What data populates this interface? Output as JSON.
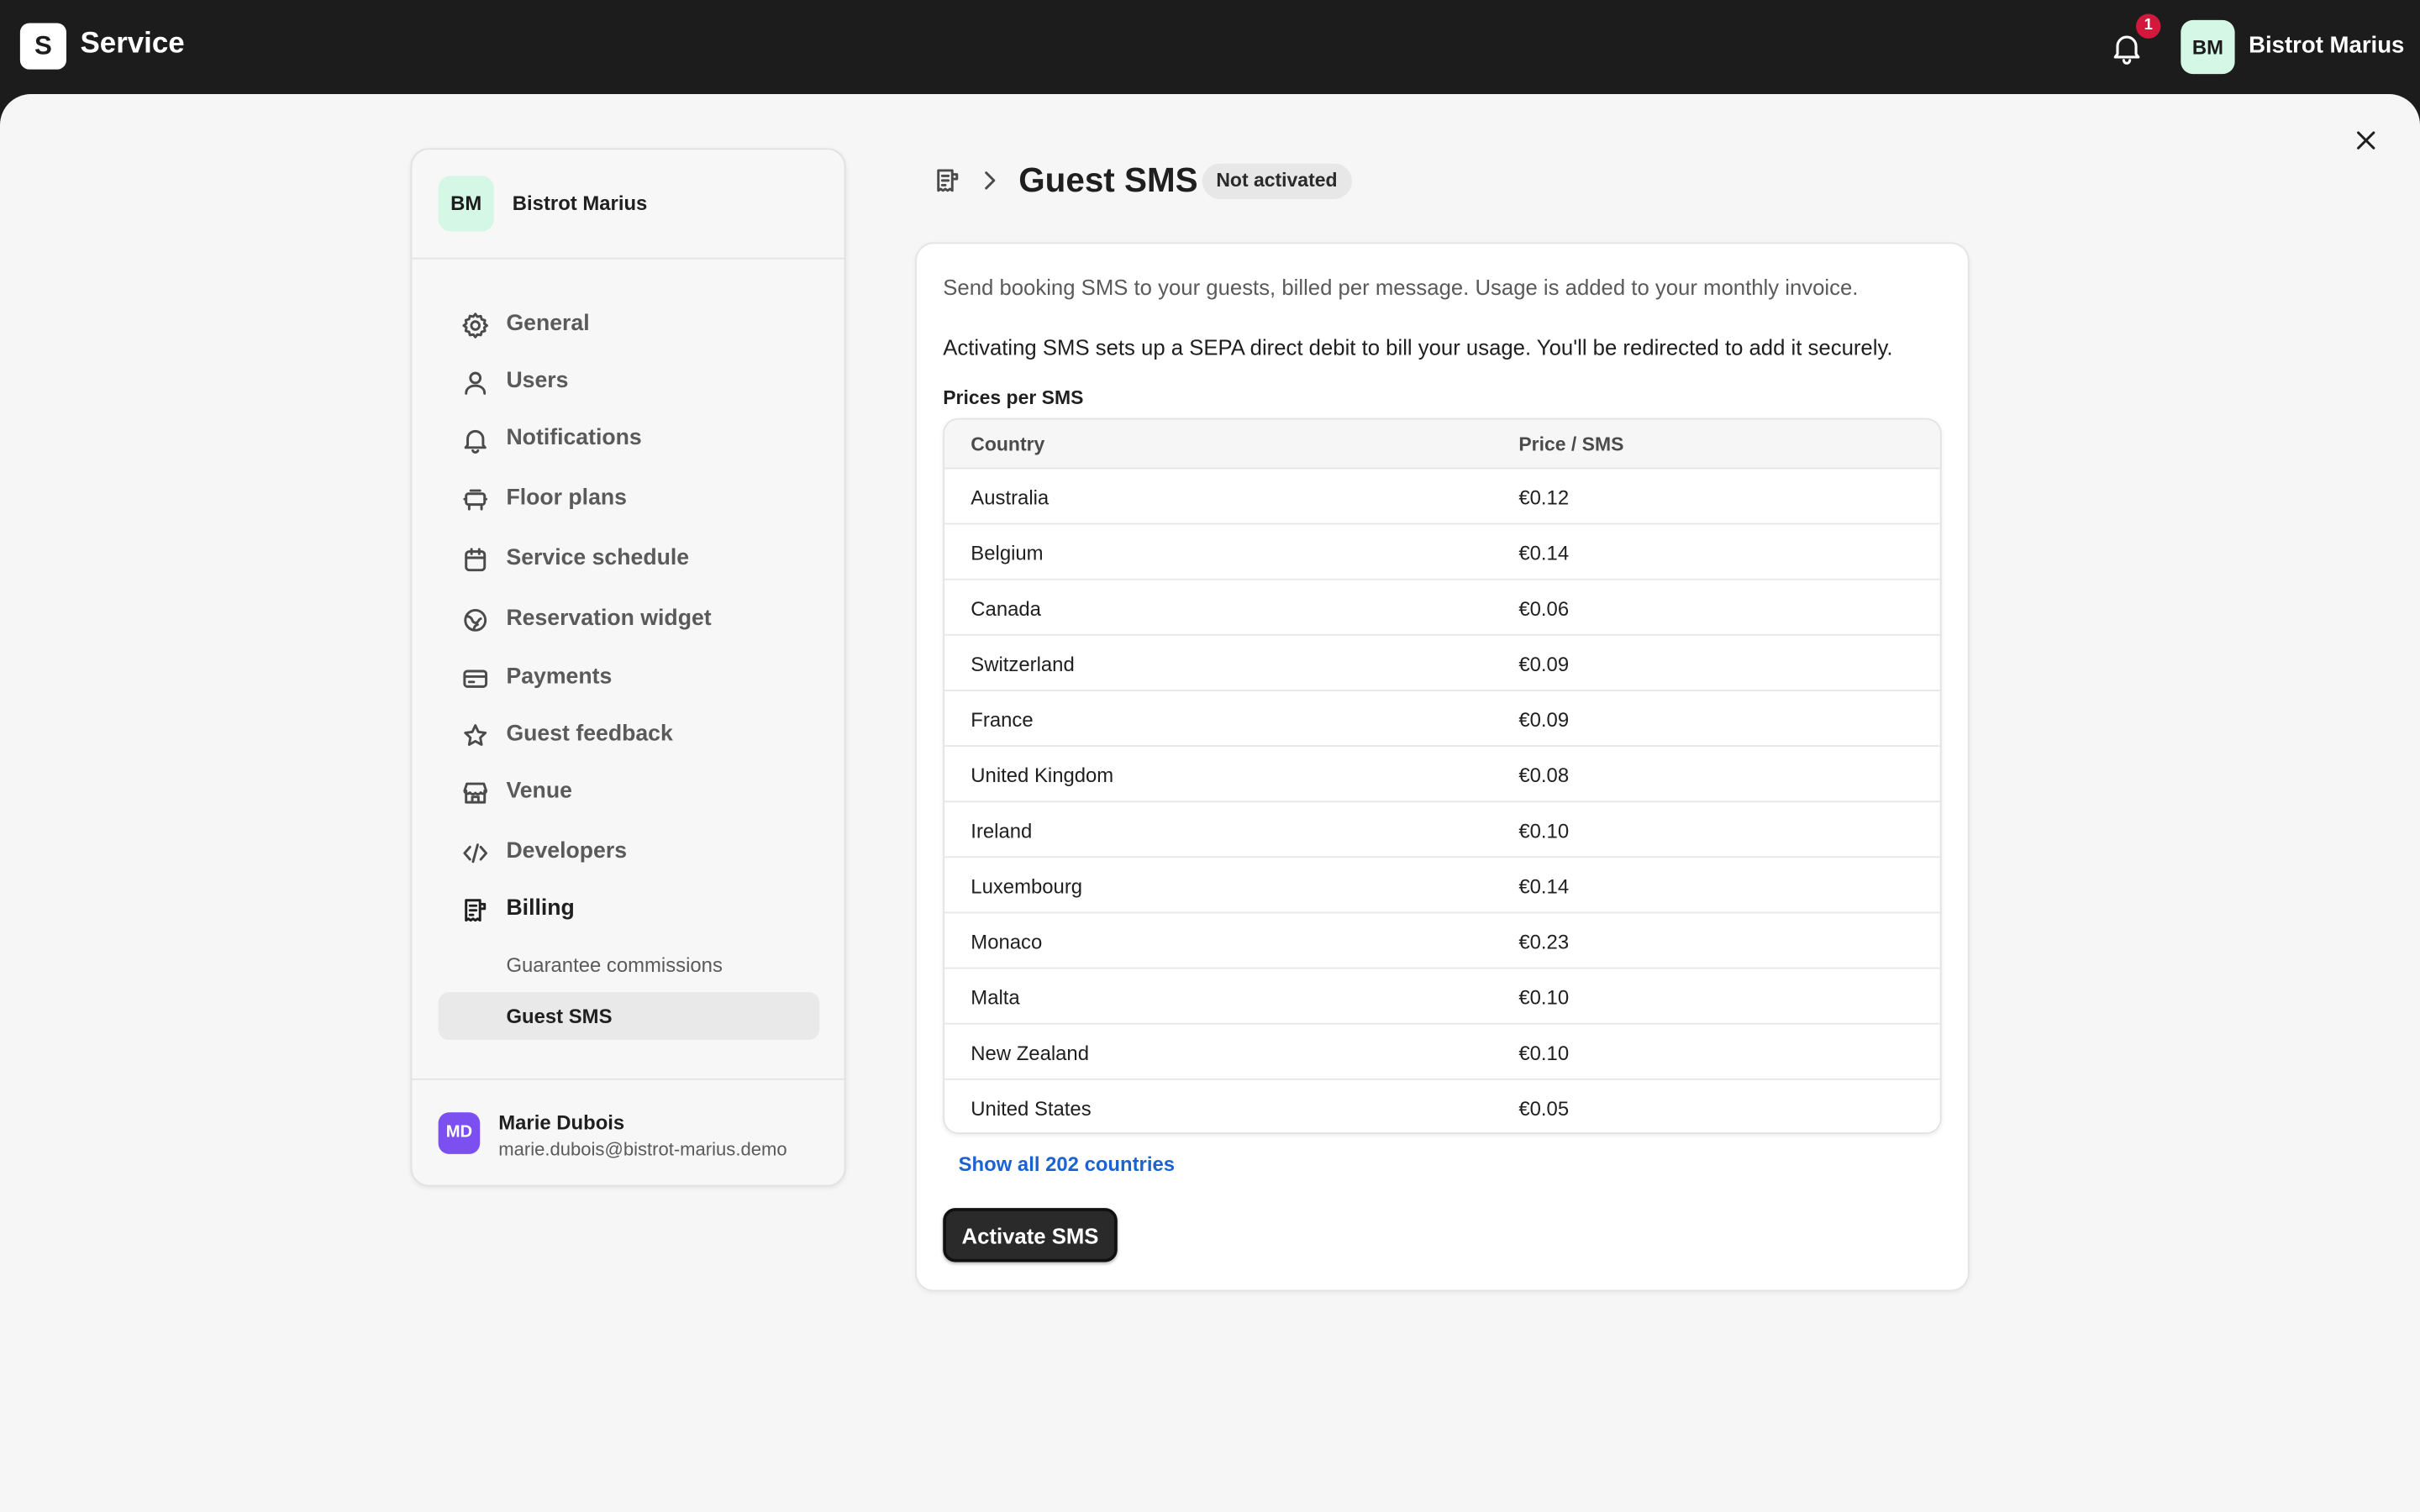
{
  "topbar": {
    "logo_letter": "S",
    "app_name": "Service",
    "notification_count": "1",
    "venue_initials": "BM",
    "venue_name": "Bistrot Marius"
  },
  "sidebar": {
    "venue_initials": "BM",
    "venue_name": "Bistrot Marius",
    "items": [
      {
        "label": "General",
        "icon": "gear-icon"
      },
      {
        "label": "Users",
        "icon": "user-icon"
      },
      {
        "label": "Notifications",
        "icon": "bell-icon"
      },
      {
        "label": "Floor plans",
        "icon": "table-icon"
      },
      {
        "label": "Service schedule",
        "icon": "calendar-icon"
      },
      {
        "label": "Reservation widget",
        "icon": "globe-icon"
      },
      {
        "label": "Payments",
        "icon": "credit-card-icon"
      },
      {
        "label": "Guest feedback",
        "icon": "star-icon"
      },
      {
        "label": "Venue",
        "icon": "store-icon"
      },
      {
        "label": "Developers",
        "icon": "code-icon"
      },
      {
        "label": "Billing",
        "icon": "receipt-icon"
      }
    ],
    "billing_sub": [
      {
        "label": "Guarantee commissions"
      },
      {
        "label": "Guest SMS"
      }
    ],
    "user": {
      "initials": "MD",
      "name": "Marie Dubois",
      "email": "marie.dubois@bistrot-marius.demo"
    }
  },
  "header": {
    "title": "Guest SMS",
    "status": "Not activated"
  },
  "main": {
    "intro": "Send booking SMS to your guests, billed per message. Usage is added to your monthly invoice.",
    "notice": "Activating SMS sets up a SEPA direct debit to bill your usage. You'll be redirected to add it securely.",
    "prices_label": "Prices per SMS",
    "table": {
      "columns": [
        "Country",
        "Price / SMS"
      ],
      "rows": [
        [
          "Australia",
          "€0.12"
        ],
        [
          "Belgium",
          "€0.14"
        ],
        [
          "Canada",
          "€0.06"
        ],
        [
          "Switzerland",
          "€0.09"
        ],
        [
          "France",
          "€0.09"
        ],
        [
          "United Kingdom",
          "€0.08"
        ],
        [
          "Ireland",
          "€0.10"
        ],
        [
          "Luxembourg",
          "€0.14"
        ],
        [
          "Monaco",
          "€0.23"
        ],
        [
          "Malta",
          "€0.10"
        ],
        [
          "New Zealand",
          "€0.10"
        ],
        [
          "United States",
          "€0.05"
        ]
      ]
    },
    "show_all": "Show all 202 countries",
    "activate_label": "Activate SMS"
  },
  "colors": {
    "topbar": "#1c1c1c",
    "badge": "#d4183d",
    "avatar_venue": "#d5f7e6",
    "avatar_user": "#7c4ff0",
    "link": "#1b63d1"
  }
}
